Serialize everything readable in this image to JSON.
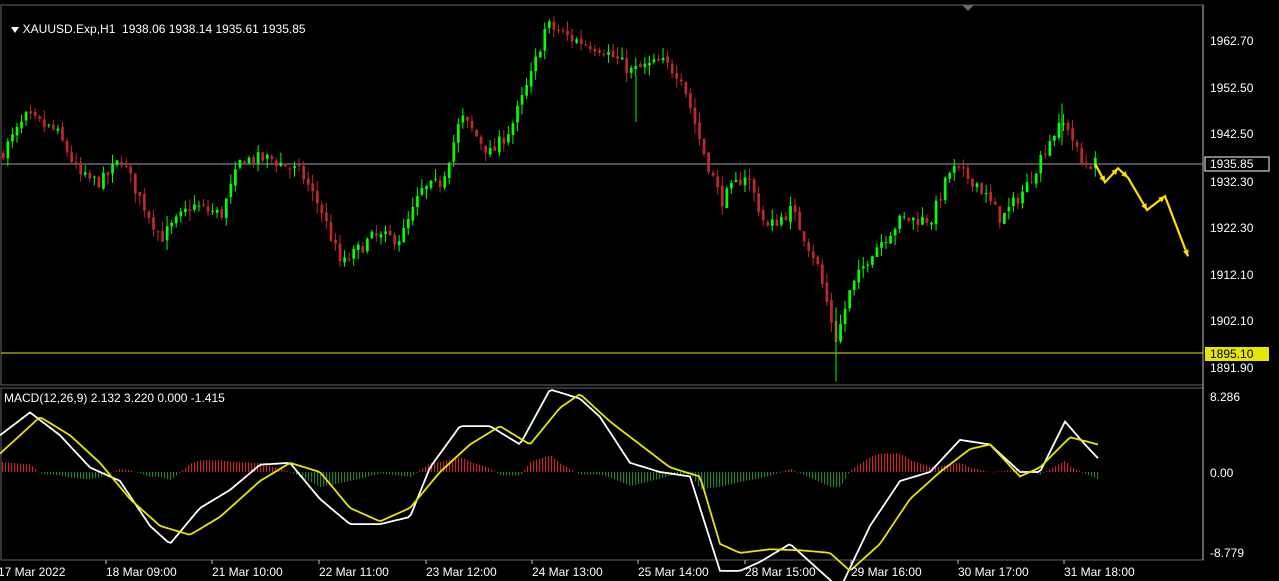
{
  "header": {
    "symbol_line": "XAUUSD.Exp,H1  1938.06 1938.14 1935.61 1935.85",
    "macd_line": "MACD(12,26,9) 2.132 3.220 0.000 -1.415"
  },
  "colors": {
    "background": "#000000",
    "bull_candle": "#00ff00",
    "bear_candle": "#c0282c",
    "grid_line": "#9aa0aa",
    "support_line": "#e6e600",
    "arrow": "#ffe000",
    "macd_line": "#ffffff",
    "signal_line": "#e6e600",
    "hist_pos": "#c0282c",
    "hist_neg": "#2e7a2e"
  },
  "price_axis": {
    "ticks": [
      "1962.70",
      "1952.50",
      "1942.50",
      "1932.30",
      "1922.30",
      "1912.10",
      "1902.10",
      "1891.90"
    ],
    "current_price": "1935.85",
    "support_price": "1895.10"
  },
  "macd_axis": {
    "ticks": [
      "8.286",
      "0.00",
      "-8.779"
    ]
  },
  "time_axis": {
    "labels": [
      "17 Mar 2022",
      "18 Mar 09:00",
      "21 Mar 10:00",
      "22 Mar 11:00",
      "23 Mar 12:00",
      "24 Mar 13:00",
      "25 Mar 14:00",
      "28 Mar 15:00",
      "29 Mar 16:00",
      "30 Mar 17:00",
      "31 Mar 18:00"
    ]
  },
  "chart_data": {
    "type": "candlestick",
    "symbol": "XAUUSD.Exp",
    "timeframe": "H1",
    "last_bar": {
      "open": 1938.06,
      "high": 1938.14,
      "low": 1935.61,
      "close": 1935.85
    },
    "price_path": [
      [
        0,
        1938
      ],
      [
        25,
        1946
      ],
      [
        55,
        1943
      ],
      [
        80,
        1933
      ],
      [
        100,
        1932
      ],
      [
        120,
        1937
      ],
      [
        140,
        1928
      ],
      [
        160,
        1920
      ],
      [
        190,
        1927
      ],
      [
        220,
        1925
      ],
      [
        240,
        1937
      ],
      [
        270,
        1937
      ],
      [
        300,
        1934
      ],
      [
        320,
        1926
      ],
      [
        340,
        1914
      ],
      [
        370,
        1920
      ],
      [
        400,
        1920
      ],
      [
        420,
        1930
      ],
      [
        440,
        1932
      ],
      [
        460,
        1946
      ],
      [
        490,
        1938
      ],
      [
        510,
        1944
      ],
      [
        530,
        1955
      ],
      [
        545,
        1966
      ],
      [
        570,
        1963
      ],
      [
        600,
        1961
      ],
      [
        630,
        1956
      ],
      [
        660,
        1958
      ],
      [
        680,
        1955
      ],
      [
        700,
        1940
      ],
      [
        720,
        1928
      ],
      [
        745,
        1934
      ],
      [
        765,
        1922
      ],
      [
        790,
        1926
      ],
      [
        815,
        1915
      ],
      [
        835,
        1898
      ],
      [
        848,
        1908
      ],
      [
        870,
        1917
      ],
      [
        900,
        1924
      ],
      [
        930,
        1924
      ],
      [
        950,
        1935
      ],
      [
        975,
        1932
      ],
      [
        1000,
        1924
      ],
      [
        1025,
        1931
      ],
      [
        1050,
        1942
      ],
      [
        1065,
        1945
      ],
      [
        1080,
        1936
      ],
      [
        1095,
        1936
      ]
    ],
    "forecast_path": [
      [
        1095,
        1936
      ],
      [
        1105,
        1932
      ],
      [
        1118,
        1935
      ],
      [
        1128,
        1933
      ],
      [
        1147,
        1926
      ],
      [
        1165,
        1929
      ],
      [
        1188,
        1916
      ]
    ],
    "macd_path": [
      [
        0,
        4
      ],
      [
        30,
        6.5
      ],
      [
        60,
        4
      ],
      [
        90,
        0.5
      ],
      [
        120,
        -1
      ],
      [
        150,
        -6
      ],
      [
        170,
        -8
      ],
      [
        200,
        -4
      ],
      [
        230,
        -2
      ],
      [
        260,
        0.8
      ],
      [
        290,
        1
      ],
      [
        320,
        -3
      ],
      [
        350,
        -5.8
      ],
      [
        380,
        -5.8
      ],
      [
        410,
        -5
      ],
      [
        430,
        0.5
      ],
      [
        460,
        5
      ],
      [
        490,
        5
      ],
      [
        520,
        3
      ],
      [
        550,
        9
      ],
      [
        580,
        8
      ],
      [
        600,
        6
      ],
      [
        630,
        1
      ],
      [
        660,
        0
      ],
      [
        690,
        -0.5
      ],
      [
        720,
        -11
      ],
      [
        740,
        -11
      ],
      [
        760,
        -10
      ],
      [
        790,
        -8
      ],
      [
        820,
        -11
      ],
      [
        840,
        -13
      ],
      [
        870,
        -6
      ],
      [
        900,
        -1
      ],
      [
        930,
        0
      ],
      [
        960,
        3.5
      ],
      [
        990,
        3
      ],
      [
        1020,
        0
      ],
      [
        1040,
        0
      ],
      [
        1065,
        5.5
      ],
      [
        1085,
        3
      ],
      [
        1098,
        1.5
      ]
    ],
    "signal_path": [
      [
        0,
        2
      ],
      [
        40,
        6
      ],
      [
        70,
        4
      ],
      [
        100,
        1
      ],
      [
        130,
        -3
      ],
      [
        160,
        -6
      ],
      [
        190,
        -7
      ],
      [
        220,
        -5
      ],
      [
        260,
        -1
      ],
      [
        290,
        1
      ],
      [
        320,
        0
      ],
      [
        350,
        -4
      ],
      [
        380,
        -5.5
      ],
      [
        410,
        -4
      ],
      [
        440,
        0
      ],
      [
        470,
        3
      ],
      [
        500,
        5
      ],
      [
        530,
        3
      ],
      [
        560,
        7
      ],
      [
        580,
        8.5
      ],
      [
        610,
        5.5
      ],
      [
        640,
        3
      ],
      [
        670,
        0.5
      ],
      [
        700,
        -0.5
      ],
      [
        720,
        -8
      ],
      [
        740,
        -9
      ],
      [
        770,
        -8.6
      ],
      [
        800,
        -8.7
      ],
      [
        830,
        -9
      ],
      [
        850,
        -11
      ],
      [
        880,
        -8
      ],
      [
        910,
        -3
      ],
      [
        940,
        0
      ],
      [
        970,
        2.5
      ],
      [
        990,
        3
      ],
      [
        1020,
        -0.5
      ],
      [
        1040,
        0.5
      ],
      [
        1070,
        3.8
      ],
      [
        1098,
        3
      ]
    ],
    "price_range": [
      1887,
      1972
    ],
    "macd_range": [
      -8.779,
      8.286
    ]
  }
}
